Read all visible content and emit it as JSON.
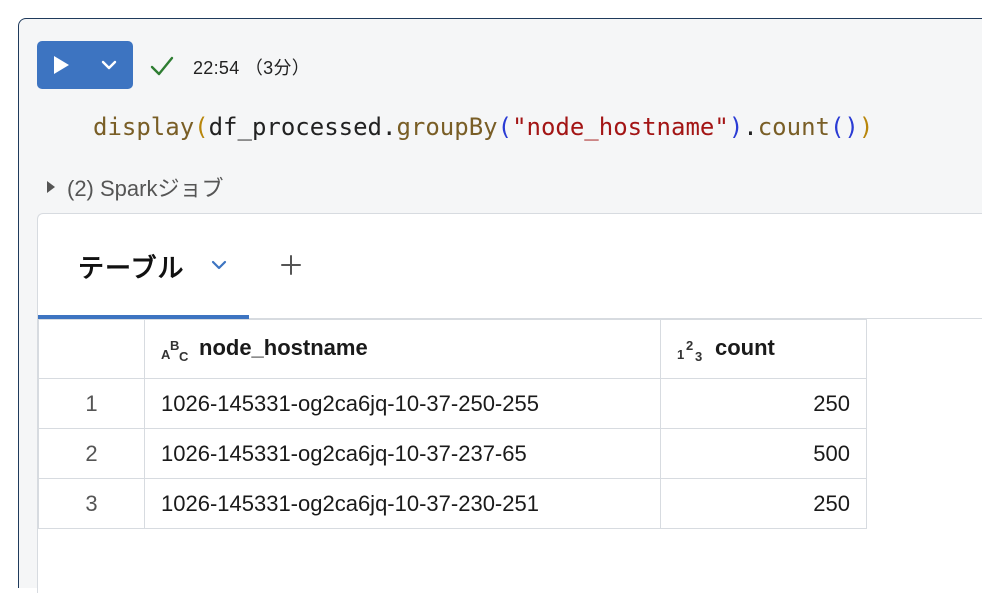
{
  "toolbar": {
    "run_icon": "play-icon",
    "dropdown_icon": "chevron-down-icon",
    "status_icon": "check-icon",
    "status_color": "#2e7d32",
    "status_text": "22:54 （3分）",
    "accent_color": "#3d74c1"
  },
  "code": {
    "fn": "display",
    "p1_open": "(",
    "obj": "df_processed",
    "dot1": ".",
    "method1": "groupBy",
    "p2_open": "(",
    "str": "\"node_hostname\"",
    "p2_close": ")",
    "dot2": ".",
    "method2": "count",
    "p3": "()",
    "p1_close": ")"
  },
  "jobs": {
    "label": "(2) Sparkジョブ"
  },
  "output": {
    "tab_label": "テーブル",
    "add_icon": "plus-icon"
  },
  "table": {
    "columns": [
      {
        "type_icon": "string-type-icon",
        "label": "node_hostname"
      },
      {
        "type_icon": "number-type-icon",
        "label": "count"
      }
    ],
    "rows": [
      {
        "index": "1",
        "node_hostname": "1026-145331-og2ca6jq-10-37-250-255",
        "count": "250"
      },
      {
        "index": "2",
        "node_hostname": "1026-145331-og2ca6jq-10-37-237-65",
        "count": "500"
      },
      {
        "index": "3",
        "node_hostname": "1026-145331-og2ca6jq-10-37-230-251",
        "count": "250"
      }
    ]
  }
}
